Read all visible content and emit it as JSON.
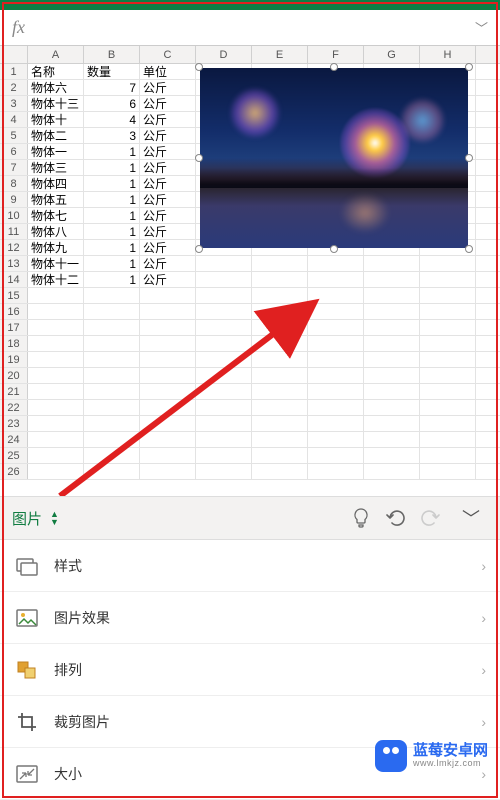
{
  "green_accent": "#0a8045",
  "formula_bar": {
    "fx": "fx",
    "value": ""
  },
  "columns": [
    "A",
    "B",
    "C",
    "D",
    "E",
    "F",
    "G",
    "H"
  ],
  "header_row": {
    "a": "名称",
    "b": "数量",
    "c": "单位"
  },
  "data_rows": [
    {
      "a": "物体六",
      "b": "7",
      "c": "公斤"
    },
    {
      "a": "物体十三",
      "b": "6",
      "c": "公斤"
    },
    {
      "a": "物体十",
      "b": "4",
      "c": "公斤"
    },
    {
      "a": "物体二",
      "b": "3",
      "c": "公斤"
    },
    {
      "a": "物体一",
      "b": "1",
      "c": "公斤"
    },
    {
      "a": "物体三",
      "b": "1",
      "c": "公斤"
    },
    {
      "a": "物体四",
      "b": "1",
      "c": "公斤"
    },
    {
      "a": "物体五",
      "b": "1",
      "c": "公斤"
    },
    {
      "a": "物体七",
      "b": "1",
      "c": "公斤"
    },
    {
      "a": "物体八",
      "b": "1",
      "c": "公斤"
    },
    {
      "a": "物体九",
      "b": "1",
      "c": "公斤"
    },
    {
      "a": "物体十一",
      "b": "1",
      "c": "公斤"
    },
    {
      "a": "物体十二",
      "b": "1",
      "c": "公斤"
    }
  ],
  "total_rows_visible": 26,
  "toolbar": {
    "tab_label": "图片",
    "idea_icon": "lightbulb-icon",
    "undo_icon": "undo-icon",
    "redo_icon": "redo-icon",
    "expand_icon": "chevron-down-icon"
  },
  "menu": {
    "styles": "样式",
    "effects": "图片效果",
    "arrange": "排列",
    "crop": "裁剪图片",
    "size": "大小"
  },
  "watermark": {
    "title": "蓝莓安卓网",
    "url": "www.lmkjz.com"
  }
}
